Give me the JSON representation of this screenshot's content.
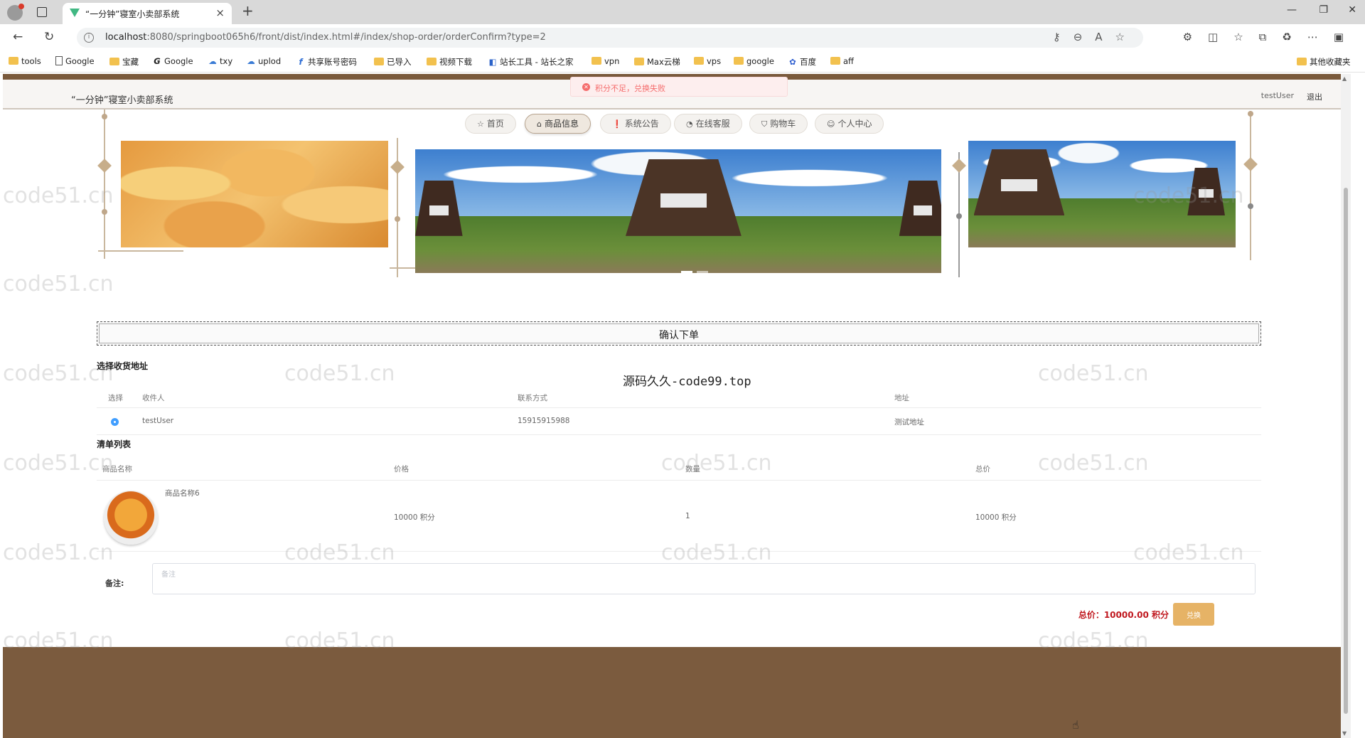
{
  "browser": {
    "tab_title": "“一分钟”寝室小卖部系统",
    "url_host": "localhost",
    "url_rest": ":8080/springboot065h6/front/dist/index.html#/index/shop-order/orderConfirm?type=2",
    "bookmarks": [
      "tools",
      "Google",
      "宝藏",
      "Google",
      "txy",
      "uplod",
      "共享账号密码",
      "已导入",
      "视频下载",
      "站长工具 - 站长之家",
      "vpn",
      "Max云梯",
      "vps",
      "google",
      "百度",
      "aff"
    ],
    "other_bookmarks": "其他收藏夹"
  },
  "header": {
    "site_title": "“一分钟”寝室小卖部系统",
    "user": "testUser",
    "logout": "退出"
  },
  "toast": {
    "message": "积分不足，兑换失败"
  },
  "nav": [
    {
      "icon": "☆",
      "label": "首页"
    },
    {
      "icon": "⌂",
      "label": "商品信息"
    },
    {
      "icon": "❗",
      "label": "系统公告"
    },
    {
      "icon": "◔",
      "label": "在线客服"
    },
    {
      "icon": "⛉",
      "label": "购物车"
    },
    {
      "icon": "☺",
      "label": "个人中心"
    }
  ],
  "order": {
    "title": "确认下单",
    "overlay_text": "源码久久-code99.top",
    "address_section": "选择收货地址",
    "address_headers": [
      "选择",
      "收件人",
      "联系方式",
      "地址"
    ],
    "address_row": {
      "name": "testUser",
      "phone": "15915915988",
      "address": "测试地址"
    },
    "list_section": "清单列表",
    "item_headers": [
      "商品名称",
      "价格",
      "数量",
      "总价"
    ],
    "item_row": {
      "name": "商品名称6",
      "price": "10000 积分",
      "qty": "1",
      "total": "10000 积分"
    },
    "remark_label": "备注:",
    "remark_placeholder": "备注",
    "total_label": "总价：10000.00 积分",
    "exchange_button": "兑换"
  },
  "watermark": "code51.cn"
}
